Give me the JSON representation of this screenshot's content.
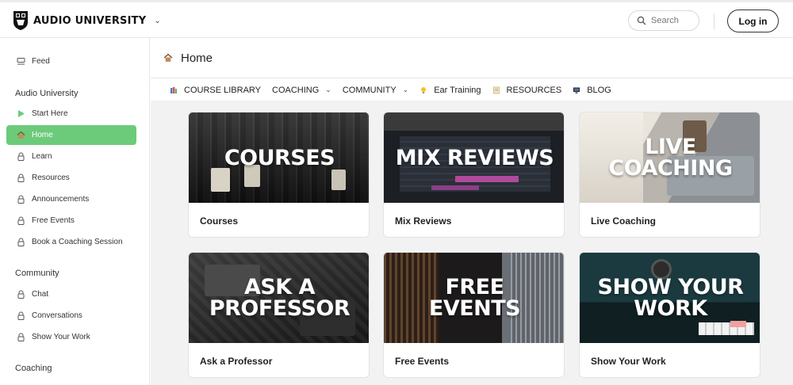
{
  "brand": {
    "name": "AUDIO UNIVERSITY"
  },
  "search": {
    "placeholder": "Search"
  },
  "login": {
    "label": "Log in"
  },
  "sidebar": {
    "feed": "Feed",
    "group1": {
      "heading": "Audio University",
      "items": [
        "Start Here",
        "Home",
        "Learn",
        "Resources",
        "Announcements",
        "Free Events",
        "Book a Coaching Session"
      ]
    },
    "group2": {
      "heading": "Community",
      "items": [
        "Chat",
        "Conversations",
        "Show Your Work"
      ]
    },
    "group3": {
      "heading": "Coaching"
    }
  },
  "page": {
    "title": "Home"
  },
  "nav": {
    "items": [
      "COURSE LIBRARY",
      "COACHING",
      "COMMUNITY",
      "Ear Training",
      "RESOURCES",
      "BLOG"
    ]
  },
  "cards": [
    {
      "image_text": "COURSES",
      "label": "Courses"
    },
    {
      "image_text": "MIX REVIEWS",
      "label": "Mix Reviews"
    },
    {
      "image_text": "LIVE\nCOACHING",
      "label": "Live Coaching"
    },
    {
      "image_text": "ASK A\nPROFESSOR",
      "label": "Ask a Professor"
    },
    {
      "image_text": "FREE\nEVENTS",
      "label": "Free Events"
    },
    {
      "image_text": "SHOW YOUR\nWORK",
      "label": "Show Your Work"
    }
  ],
  "colors": {
    "accent_green": "#6ccb7a"
  }
}
